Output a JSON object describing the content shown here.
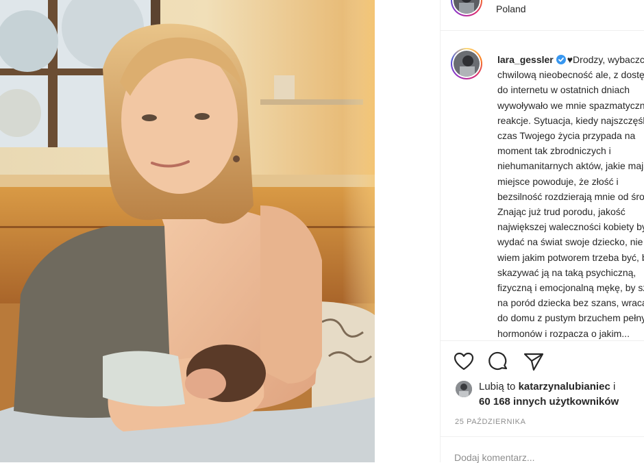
{
  "post": {
    "location": "Poland",
    "username": "lara_gessler",
    "caption_lines": [
      "♥Drodzy, wybaczcie",
      "chwilową nieobecność ale, z dostępem",
      "do internetu w ostatnich dniach",
      "wywoływało we mnie spazmatyczne",
      "reakcje. Sytuacja, kiedy najszczęśliwszy",
      "czas Twojego życia przypada na",
      "moment tak zbrodniczych i",
      "niehumanitarnych aktów, jakie mają",
      "miejsce powoduje, że złość i",
      "bezsilność rozdzierają mnie od środka.",
      "Znając już trud porodu, jakość",
      "największej waleczności kobiety by",
      "wydać na świat swoje dziecko, nie",
      "wiem jakim potworem trzeba być, by",
      "skazywać ją na taką psychiczną,",
      "fizyczną i emocjonalną mękę, by szła",
      "na poród dziecka bez szans, wracając",
      "do domu z pustym brzuchem pełnym",
      "hormonów i rozpacza o jakim..."
    ],
    "likes": {
      "prefix": "Lubią to",
      "user": "katarzynalubianiec",
      "conj": "i",
      "count": "60 168 innych użytkowników"
    },
    "date": "25 PAŹDZIERNIKA",
    "comment_placeholder": "Dodaj komentarz..."
  },
  "icons": [
    "heart-icon",
    "comment-icon",
    "share-icon",
    "verified-badge-icon"
  ],
  "colors": {
    "verified": "#3897f0",
    "text": "#262626",
    "muted": "#8e8e8e",
    "border": "#efefef"
  }
}
